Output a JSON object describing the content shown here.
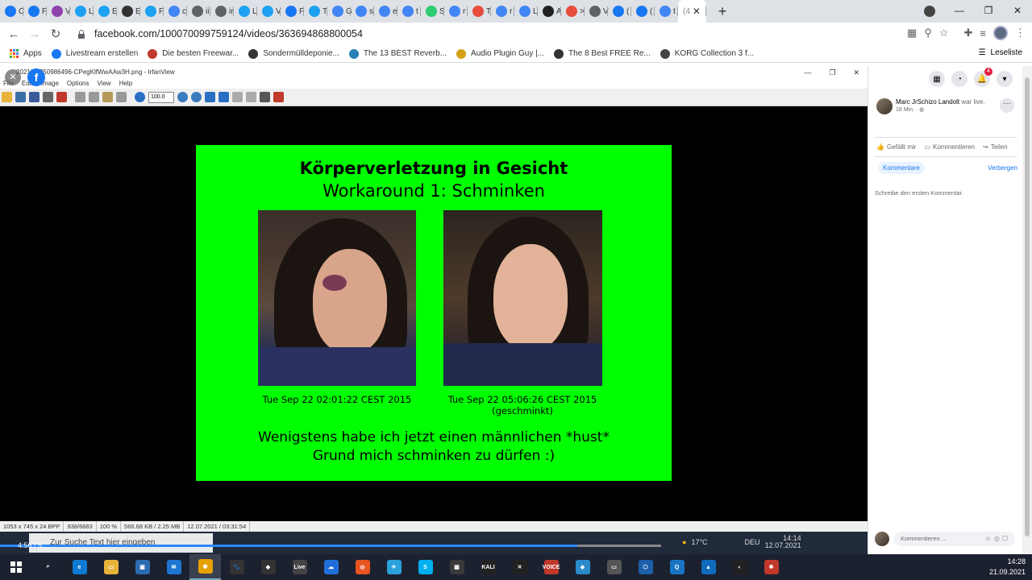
{
  "browser": {
    "tabs": [
      {
        "icon": "facebook-icon",
        "label": "C",
        "color": "#1877f2"
      },
      {
        "icon": "facebook-icon",
        "label": "F",
        "color": "#1877f2"
      },
      {
        "icon": "u-icon",
        "label": "V",
        "color": "#8e44ad"
      },
      {
        "icon": "twitter-icon",
        "label": "L",
        "color": "#1da1f2"
      },
      {
        "icon": "twitter-icon",
        "label": "E",
        "color": "#1da1f2"
      },
      {
        "icon": "wikipedia-icon",
        "label": "E",
        "color": "#333333"
      },
      {
        "icon": "twitter-icon",
        "label": "F",
        "color": "#1da1f2"
      },
      {
        "icon": "google-icon",
        "label": "c",
        "color": "#4285f4"
      },
      {
        "icon": "globe-icon",
        "label": "ii",
        "color": "#5f6368"
      },
      {
        "icon": "globe-icon",
        "label": "ir",
        "color": "#5f6368"
      },
      {
        "icon": "twitter-icon",
        "label": "L",
        "color": "#1da1f2"
      },
      {
        "icon": "twitter-icon",
        "label": "V",
        "color": "#1da1f2"
      },
      {
        "icon": "facebook-icon",
        "label": "F",
        "color": "#1877f2"
      },
      {
        "icon": "twitter-icon",
        "label": "T",
        "color": "#1da1f2"
      },
      {
        "icon": "google-icon",
        "label": "G",
        "color": "#4285f4"
      },
      {
        "icon": "google-icon",
        "label": "s",
        "color": "#4285f4"
      },
      {
        "icon": "google-icon",
        "label": "e",
        "color": "#4285f4"
      },
      {
        "icon": "google-icon",
        "label": "t",
        "color": "#4285f4"
      },
      {
        "icon": "green-icon",
        "label": "S",
        "color": "#2ecc71"
      },
      {
        "icon": "google-icon",
        "label": "r",
        "color": "#4285f4"
      },
      {
        "icon": "red-icon",
        "label": "T",
        "color": "#e74c3c"
      },
      {
        "icon": "google-icon",
        "label": "r",
        "color": "#4285f4"
      },
      {
        "icon": "google-icon",
        "label": "L",
        "color": "#4285f4"
      },
      {
        "icon": "amazon-icon",
        "label": "A",
        "color": "#222222"
      },
      {
        "icon": "red-icon",
        "label": ">",
        "color": "#e74c3c"
      },
      {
        "icon": "globe-icon",
        "label": "V",
        "color": "#5f6368"
      },
      {
        "icon": "facebook-icon",
        "label": "(",
        "color": "#1877f2"
      },
      {
        "icon": "facebook-icon",
        "label": "(",
        "color": "#1877f2"
      },
      {
        "icon": "google-icon",
        "label": "t",
        "color": "#4285f4"
      }
    ],
    "active_tab": {
      "label": "(4",
      "close": "✕"
    },
    "new_tab": "+",
    "window_controls": {
      "minimize": "—",
      "restore": "❐",
      "close": "✕"
    },
    "url": "facebook.com/100070099759124/videos/363694868800054"
  },
  "bookmarks": {
    "apps": "Apps",
    "items": [
      {
        "label": "Livestream erstellen",
        "icon": "facebook-icon",
        "color": "#1877f2"
      },
      {
        "label": "Die besten Freewar...",
        "icon": "star-icon",
        "color": "#c0392b"
      },
      {
        "label": "Sondermülldeponie...",
        "icon": "wikipedia-icon",
        "color": "#333333"
      },
      {
        "label": "The 13 BEST Reverb...",
        "icon": "wave-icon",
        "color": "#2980b9"
      },
      {
        "label": "Audio Plugin Guy |...",
        "icon": "plugin-icon",
        "color": "#d4a017"
      },
      {
        "label": "The 8 Best FREE Re...",
        "icon": "moon-icon",
        "color": "#333333"
      },
      {
        "label": "KORG Collection 3 f...",
        "icon": "korg-icon",
        "color": "#444444"
      }
    ],
    "reading_list": "Leseliste"
  },
  "irfanview": {
    "title": "20210...250986496-CPegKlfWwAAw3H.png - IrfanView",
    "menu": [
      "File",
      "Edit",
      "Image",
      "Options",
      "View",
      "Help"
    ],
    "zoom_value": "100.0",
    "status": [
      "1053 x 745 x 24 BPP",
      "938/6683",
      "100 %",
      "566.68 KB / 2.25 MB",
      "12.07.2021 / 03:31:54"
    ]
  },
  "slide": {
    "title": "Körperverletzung in Gesicht",
    "subtitle": "Workaround 1: Schminken",
    "caption_left": "Tue Sep 22 02:01:22 CEST 2015",
    "caption_right_line1": "Tue Sep 22 05:06:26 CEST 2015",
    "caption_right_line2": "(geschminkt)",
    "bottom_line1": "Wenigstens habe ich jetzt einen männlichen *hust*",
    "bottom_line2": "Grund mich schminken zu dürfen :)",
    "background": "#00ff00"
  },
  "inner_taskbar": {
    "search_placeholder": "Zur Suche Text hier eingeben",
    "time_elapsed": "4:56 / 5:...",
    "tray_temp": "17°C",
    "tray_lang": "DEU",
    "tray_time": "14:14",
    "tray_date": "12.07.2021"
  },
  "facebook": {
    "notification_count": "4",
    "poster_name": "Marc JrSchizo Landolt",
    "poster_status": "war live.",
    "post_time": "18 Min. ·",
    "actions": {
      "like": "Gefällt mir",
      "comment": "Kommentieren",
      "share": "Teilen"
    },
    "comments_tab": "Kommentare",
    "hide": "Verbergen",
    "first_comment": "Schreibe den ersten Kommentar.",
    "comment_placeholder": "Kommentieren ..."
  },
  "taskbar": {
    "time": "14:28",
    "date": "21.09.2021",
    "apps": [
      {
        "name": "search-icon",
        "label": "⌕",
        "color": "#1c2130"
      },
      {
        "name": "edge-icon",
        "label": "e",
        "color": "#0f7bd3"
      },
      {
        "name": "explorer-icon",
        "label": "▭",
        "color": "#e8b33a"
      },
      {
        "name": "store-icon",
        "label": "▣",
        "color": "#2b6cb0"
      },
      {
        "name": "mail-icon",
        "label": "✉",
        "color": "#1d76d2"
      },
      {
        "name": "chrome-icon",
        "label": "◉",
        "color": "#e6a100"
      },
      {
        "name": "cat-icon",
        "label": "🐾",
        "color": "#333"
      },
      {
        "name": "inkscape-icon",
        "label": "◆",
        "color": "#333"
      },
      {
        "name": "live-icon",
        "label": "Live",
        "color": "#444"
      },
      {
        "name": "onedrive-icon",
        "label": "☁",
        "color": "#1e6fd9"
      },
      {
        "name": "ubuntu-icon",
        "label": "◎",
        "color": "#e95420"
      },
      {
        "name": "telegram-icon",
        "label": "✈",
        "color": "#2aa1da"
      },
      {
        "name": "skype-icon",
        "label": "S",
        "color": "#00aff0"
      },
      {
        "name": "circuit-icon",
        "label": "▦",
        "color": "#3a3a3a"
      },
      {
        "name": "kali-icon",
        "label": "KALI",
        "color": "#222"
      },
      {
        "name": "x-icon",
        "label": "✕",
        "color": "#222"
      },
      {
        "name": "voicemeeter-icon",
        "label": "VOICE",
        "color": "#c0392b"
      },
      {
        "name": "app-icon",
        "label": "◈",
        "color": "#2a8acb"
      },
      {
        "name": "window-icon",
        "label": "▭",
        "color": "#555"
      },
      {
        "name": "virtualbox-icon",
        "label": "⬡",
        "color": "#1b5fa8"
      },
      {
        "name": "q-icon",
        "label": "Q",
        "color": "#1a74c4"
      },
      {
        "name": "photos-icon",
        "label": "▲",
        "color": "#0f6cbd"
      },
      {
        "name": "obs-icon",
        "label": "◐",
        "color": "#222"
      },
      {
        "name": "irfanview-icon",
        "label": "✱",
        "color": "#c0392b"
      }
    ]
  }
}
